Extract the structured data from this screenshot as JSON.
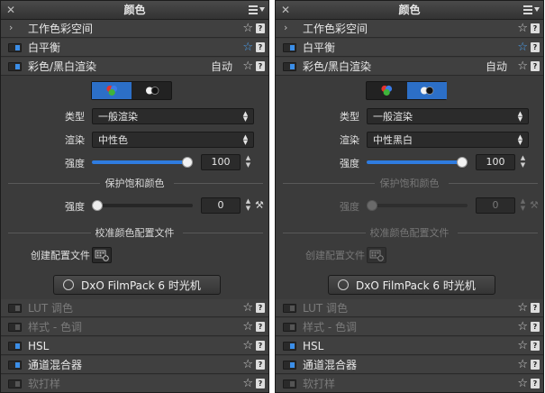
{
  "panels": [
    {
      "title": "颜色",
      "header_rows": [
        {
          "label": "工作色彩空间"
        },
        {
          "label": "白平衡"
        },
        {
          "label": "彩色/黑白渲染",
          "auto": "自动"
        }
      ],
      "mode_selected": "color",
      "type_label": "类型",
      "type_value": "一般渲染",
      "render_label": "渲染",
      "render_value": "中性色",
      "intensity_label": "强度",
      "intensity_value": "100",
      "intensity_fraction": 1.0,
      "protect_heading": "保护饱和颜色",
      "protect_intensity_label": "强度",
      "protect_intensity_value": "0",
      "protect_fraction": 0.0,
      "protect_enabled": true,
      "calibration_heading": "校准颜色配置文件",
      "create_profile_label": "创建配置文件",
      "filmpack_button": "DxO FilmPack 6 时光机",
      "footer_rows": [
        {
          "label": "LUT 调色",
          "enabled": false
        },
        {
          "label": "样式 - 色调",
          "enabled": false
        },
        {
          "label": "HSL",
          "enabled": true
        },
        {
          "label": "通道混合器",
          "enabled": true
        },
        {
          "label": "软打样",
          "enabled": false
        }
      ]
    },
    {
      "title": "颜色",
      "header_rows": [
        {
          "label": "工作色彩空间"
        },
        {
          "label": "白平衡"
        },
        {
          "label": "彩色/黑白渲染",
          "auto": "自动"
        }
      ],
      "mode_selected": "bw",
      "type_label": "类型",
      "type_value": "一般渲染",
      "render_label": "渲染",
      "render_value": "中性黑白",
      "intensity_label": "强度",
      "intensity_value": "100",
      "intensity_fraction": 1.0,
      "protect_heading": "保护饱和颜色",
      "protect_intensity_label": "强度",
      "protect_intensity_value": "0",
      "protect_fraction": 0.0,
      "protect_enabled": false,
      "calibration_heading": "校准颜色配置文件",
      "create_profile_label": "创建配置文件",
      "filmpack_button": "DxO FilmPack 6 时光机",
      "footer_rows": [
        {
          "label": "LUT 调色",
          "enabled": false
        },
        {
          "label": "样式 - 色调",
          "enabled": false
        },
        {
          "label": "HSL",
          "enabled": true
        },
        {
          "label": "通道混合器",
          "enabled": true
        },
        {
          "label": "软打样",
          "enabled": false
        }
      ]
    }
  ],
  "colors": {
    "accent": "#2f7ce0",
    "star_active": "#4aa0f0",
    "panel_bg": "#3b3b3b"
  }
}
